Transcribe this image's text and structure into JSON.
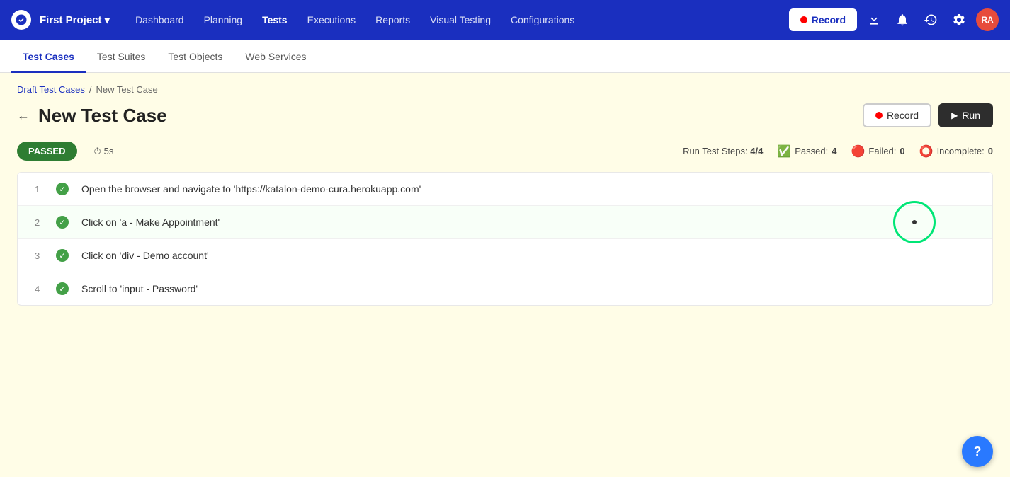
{
  "nav": {
    "project_name": "First Project",
    "links": [
      {
        "id": "dashboard",
        "label": "Dashboard",
        "active": false
      },
      {
        "id": "planning",
        "label": "Planning",
        "active": false
      },
      {
        "id": "tests",
        "label": "Tests",
        "active": true
      },
      {
        "id": "executions",
        "label": "Executions",
        "active": false
      },
      {
        "id": "reports",
        "label": "Reports",
        "active": false
      },
      {
        "id": "visual-testing",
        "label": "Visual Testing",
        "active": false
      },
      {
        "id": "configurations",
        "label": "Configurations",
        "active": false
      }
    ],
    "record_button": "Record",
    "avatar_initials": "RA"
  },
  "sub_nav": {
    "tabs": [
      {
        "id": "test-cases",
        "label": "Test Cases",
        "active": true
      },
      {
        "id": "test-suites",
        "label": "Test Suites",
        "active": false
      },
      {
        "id": "test-objects",
        "label": "Test Objects",
        "active": false
      },
      {
        "id": "web-services",
        "label": "Web Services",
        "active": false
      }
    ]
  },
  "breadcrumb": {
    "parent": "Draft Test Cases",
    "current": "New Test Case",
    "separator": "/"
  },
  "page": {
    "title": "New Test Case",
    "record_button": "Record",
    "run_button": "Run"
  },
  "status": {
    "badge": "PASSED",
    "timer_icon": "⏱",
    "duration": "5s",
    "run_steps_label": "Run Test Steps:",
    "run_steps_value": "4/4",
    "passed_label": "Passed:",
    "passed_count": "4",
    "failed_label": "Failed:",
    "failed_count": "0",
    "incomplete_label": "Incomplete:",
    "incomplete_count": "0"
  },
  "steps": [
    {
      "num": "1",
      "status": "passed",
      "text": "Open the browser and navigate to 'https://katalon-demo-cura.herokuapp.com'"
    },
    {
      "num": "2",
      "status": "passed",
      "text": "Click on 'a - Make Appointment'",
      "highlighted": true
    },
    {
      "num": "3",
      "status": "passed",
      "text": "Click on 'div - Demo account'"
    },
    {
      "num": "4",
      "status": "passed",
      "text": "Scroll to 'input - Password'"
    }
  ],
  "help_button": "?"
}
